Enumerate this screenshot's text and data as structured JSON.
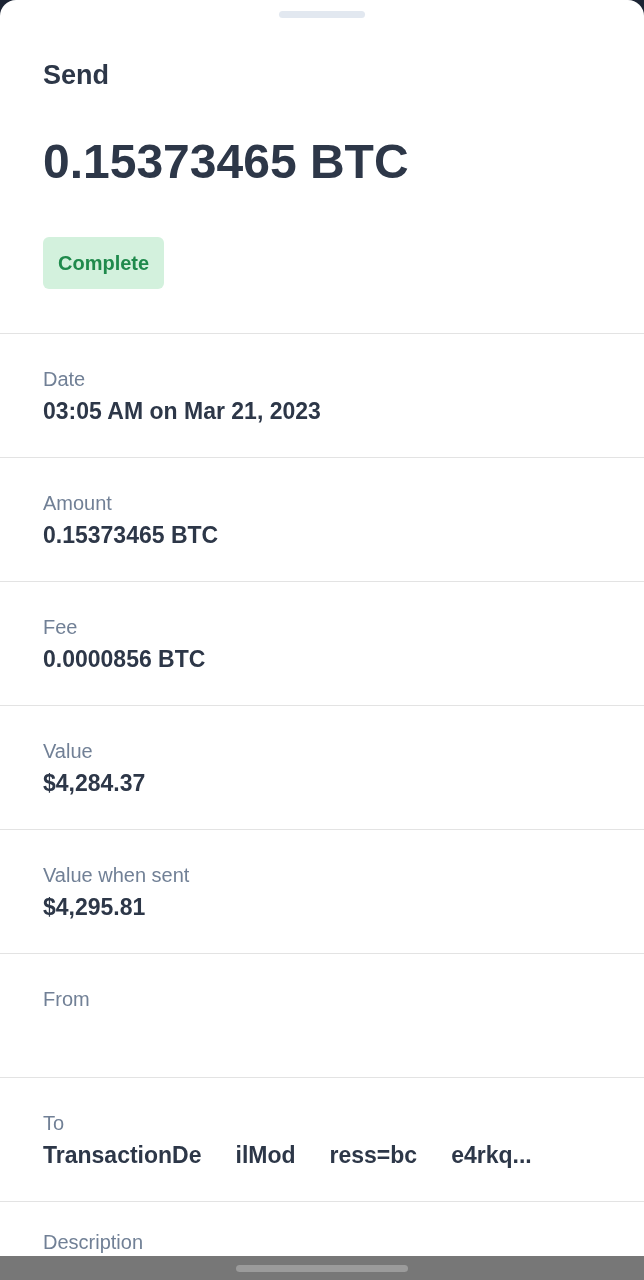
{
  "sheet": {
    "title": "Send",
    "amount": "0.15373465 BTC",
    "status": {
      "label": "Complete",
      "kind": "complete"
    }
  },
  "details": [
    {
      "label": "Date",
      "value": "03:05 AM on Mar 21, 2023"
    },
    {
      "label": "Amount",
      "value": "0.15373465 BTC"
    },
    {
      "label": "Fee",
      "value": "0.0000856 BTC"
    },
    {
      "label": "Value",
      "value": "$4,284.37"
    },
    {
      "label": "Value when sent",
      "value": "$4,295.81"
    },
    {
      "label": "From"
    },
    {
      "label": "To",
      "value_parts": [
        "TransactionDe",
        "ilMod",
        "ress=bc",
        "e4rkq..."
      ]
    },
    {
      "label": "Description"
    }
  ]
}
